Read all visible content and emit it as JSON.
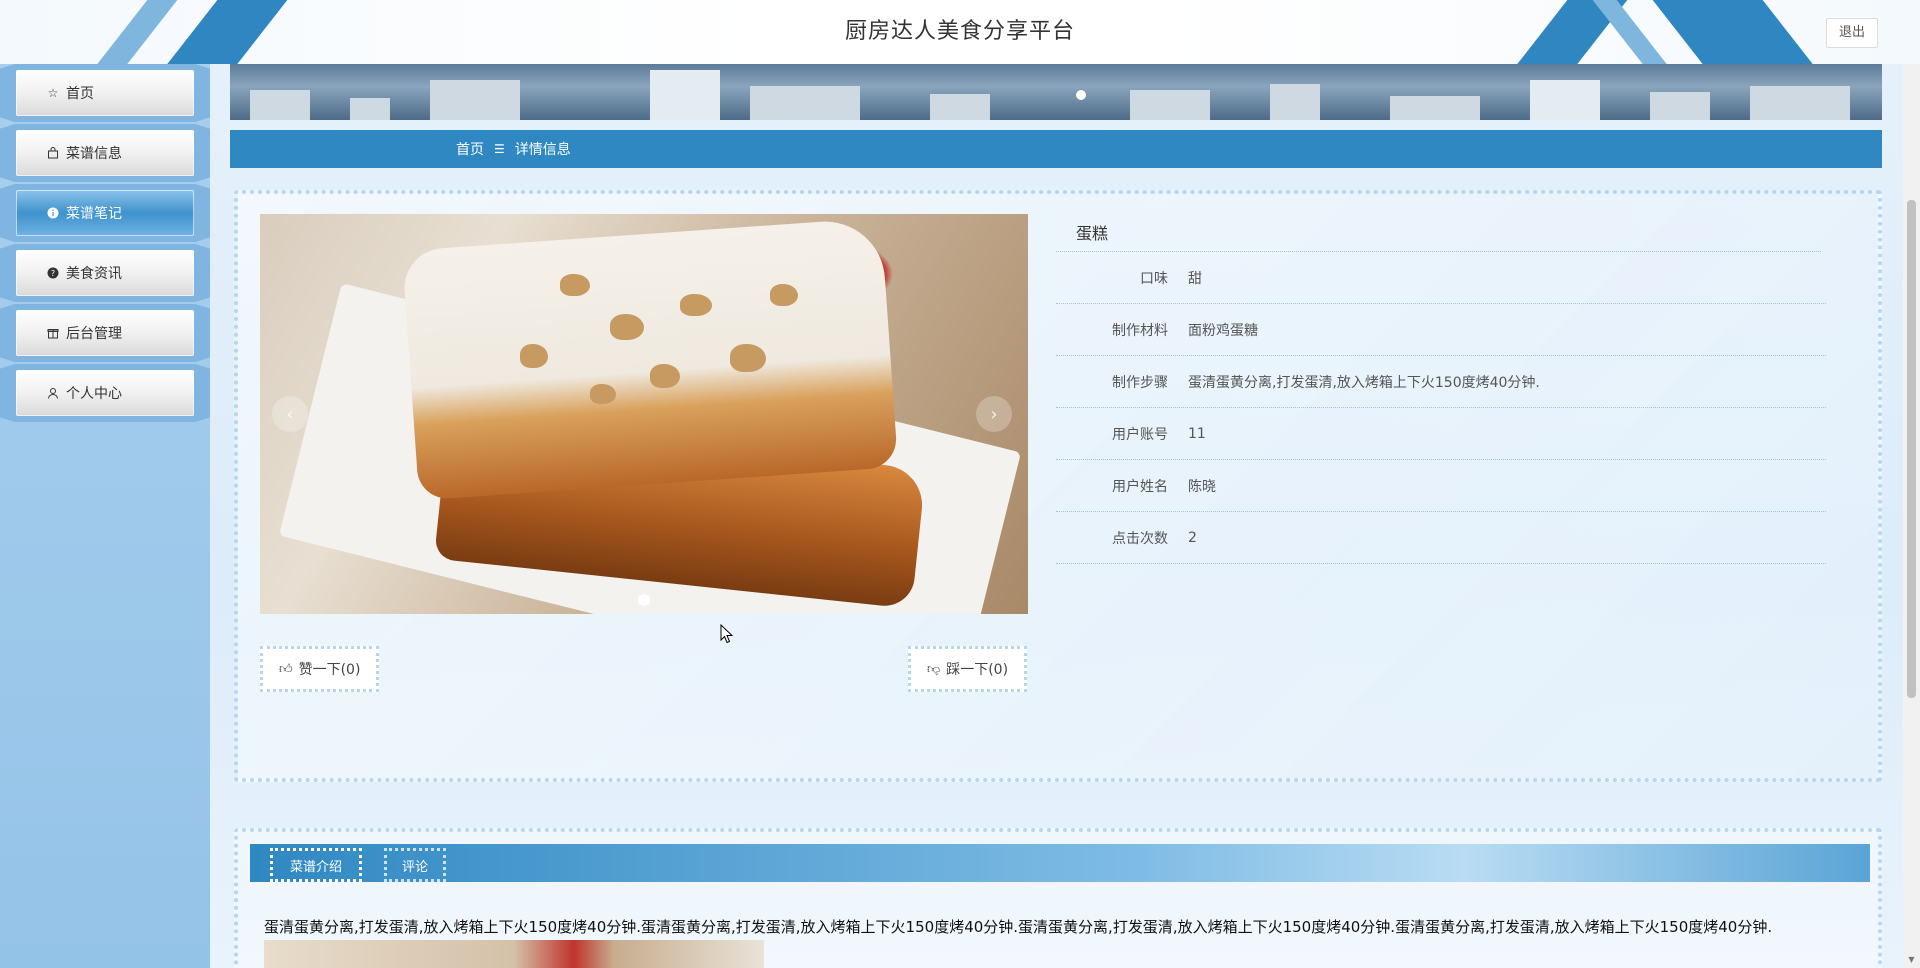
{
  "header": {
    "title": "厨房达人美食分享平台",
    "logout_label": "退出"
  },
  "sidebar": {
    "items": [
      {
        "label": "首页",
        "icon": "star-icon"
      },
      {
        "label": "菜谱信息",
        "icon": "bag-icon"
      },
      {
        "label": "菜谱笔记",
        "icon": "info-circle-icon",
        "active": true
      },
      {
        "label": "美食资讯",
        "icon": "question-circle-icon"
      },
      {
        "label": "后台管理",
        "icon": "gift-box-icon"
      },
      {
        "label": "个人中心",
        "icon": "user-icon"
      }
    ]
  },
  "breadcrumb": {
    "home": "首页",
    "separator": "☰",
    "current": "详情信息"
  },
  "detail": {
    "name": "蛋糕",
    "fields": [
      {
        "label": "口味",
        "value": "甜"
      },
      {
        "label": "制作材料",
        "value": "面粉鸡蛋糖"
      },
      {
        "label": "制作步骤",
        "value": "蛋清蛋黄分离,打发蛋清,放入烤箱上下火150度烤40分钟."
      },
      {
        "label": "用户账号",
        "value": "11"
      },
      {
        "label": "用户姓名",
        "value": "陈晓"
      },
      {
        "label": "点击次数",
        "value": "2"
      }
    ],
    "like_label": "赞一下(0)",
    "dislike_label": "踩一下(0)"
  },
  "tabs": {
    "items": [
      "菜谱介绍",
      "评论"
    ],
    "intro_text": "蛋清蛋黄分离,打发蛋清,放入烤箱上下火150度烤40分钟.蛋清蛋黄分离,打发蛋清,放入烤箱上下火150度烤40分钟.蛋清蛋黄分离,打发蛋清,放入烤箱上下火150度烤40分钟.蛋清蛋黄分离,打发蛋清,放入烤箱上下火150度烤40分钟."
  },
  "colors": {
    "accent": "#2f88c2",
    "sidebar_bg": "#94c3e8",
    "active_nav": "#3f92cc"
  }
}
